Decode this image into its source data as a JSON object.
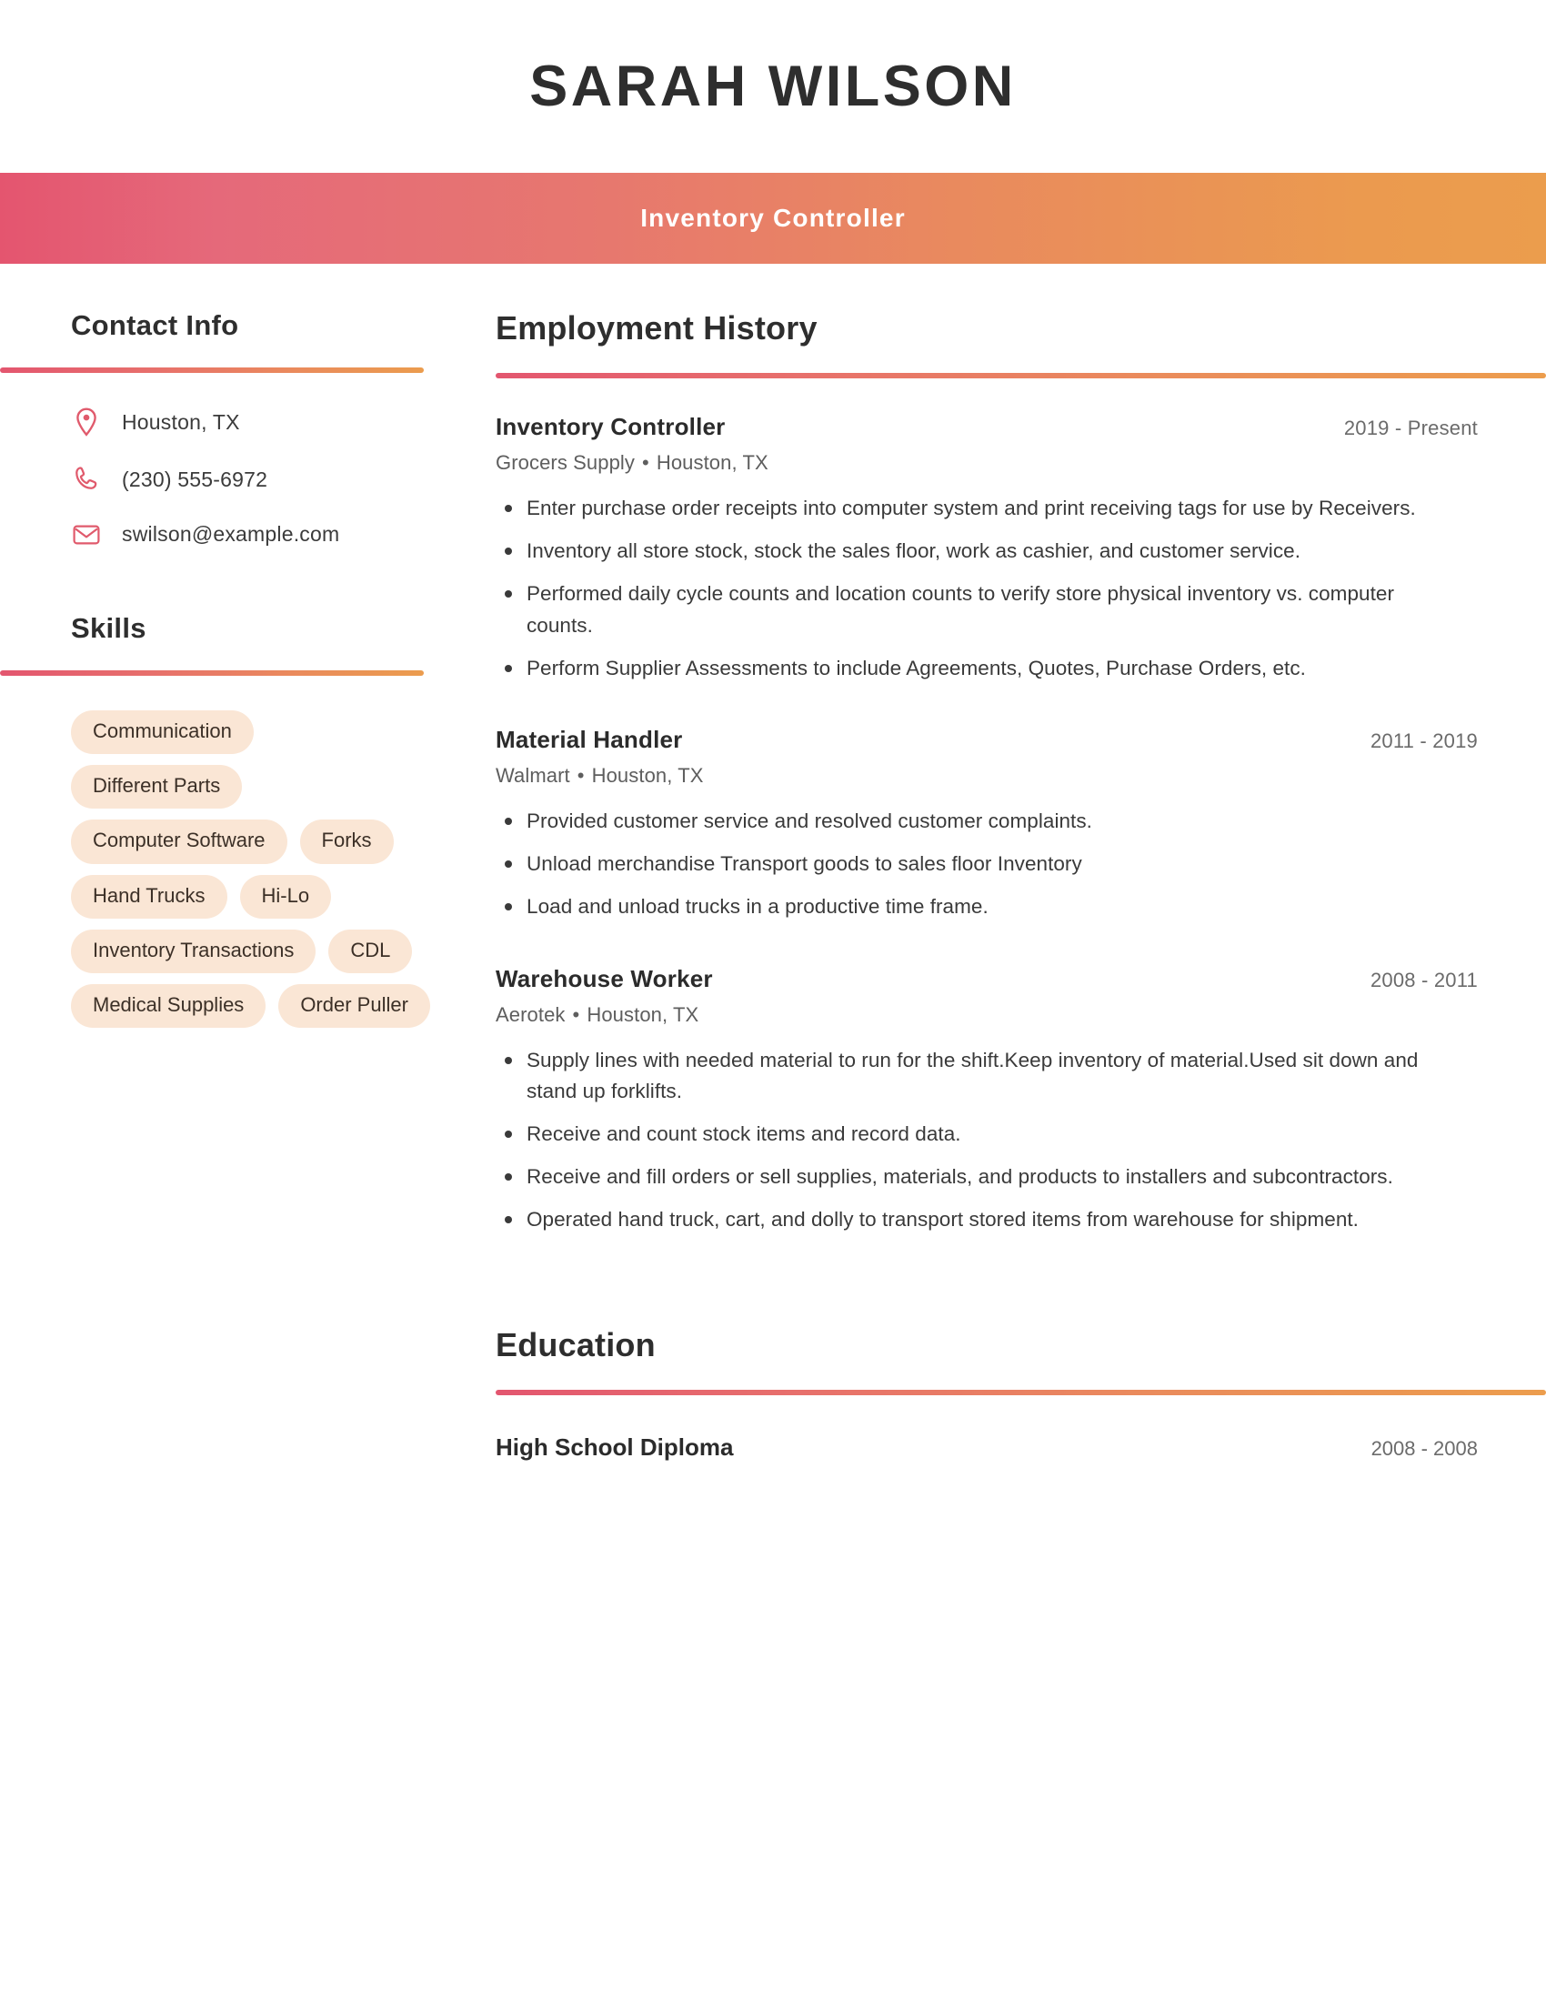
{
  "header": {
    "full_name": "SARAH WILSON",
    "job_title": "Inventory Controller",
    "band_gradient_start": "#e4556f",
    "band_gradient_end": "#eb9d4d"
  },
  "sidebar": {
    "contact": {
      "heading": "Contact Info",
      "items": [
        {
          "icon": "location-pin-icon",
          "value": "Houston, TX"
        },
        {
          "icon": "phone-icon",
          "value": "(230) 555-6972"
        },
        {
          "icon": "envelope-icon",
          "value": "swilson@example.com"
        }
      ]
    },
    "skills": {
      "heading": "Skills",
      "pill_background": "#fae6d5",
      "items": [
        "Communication",
        "Different Parts",
        "Computer Software",
        "Forks",
        "Hand Trucks",
        "Hi-Lo",
        "Inventory Transactions",
        "CDL",
        "Medical Supplies",
        "Order Puller"
      ]
    }
  },
  "main": {
    "employment": {
      "heading": "Employment History",
      "jobs": [
        {
          "role": "Inventory Controller",
          "dates": "2019 - Present",
          "company": "Grocers Supply",
          "location": "Houston, TX",
          "separator": "•",
          "bullets": [
            "Enter purchase order receipts into computer system and print receiving tags for use by Receivers.",
            "Inventory all store stock, stock the sales floor, work as cashier, and customer service.",
            "Performed daily cycle counts and location counts to verify store physical inventory vs. computer counts.",
            "Perform Supplier Assessments to include Agreements, Quotes, Purchase Orders, etc."
          ]
        },
        {
          "role": "Material Handler",
          "dates": "2011 - 2019",
          "company": "Walmart",
          "location": "Houston, TX",
          "separator": "•",
          "bullets": [
            "Provided customer service and resolved customer complaints.",
            "Unload merchandise Transport goods to sales floor Inventory",
            "Load and unload trucks in a productive time frame."
          ]
        },
        {
          "role": "Warehouse Worker",
          "dates": "2008 - 2011",
          "company": "Aerotek",
          "location": "Houston, TX",
          "separator": "•",
          "bullets": [
            "Supply lines with needed material to run for the shift.Keep inventory of material.Used sit down and stand up forklifts.",
            "Receive and count stock items and record data.",
            "Receive and fill orders or sell supplies, materials, and products to installers and subcontractors.",
            "Operated hand truck, cart, and dolly to transport stored items from warehouse for shipment."
          ]
        }
      ]
    },
    "education": {
      "heading": "Education",
      "entries": [
        {
          "degree": "High School Diploma",
          "dates": "2008 - 2008"
        }
      ]
    }
  }
}
